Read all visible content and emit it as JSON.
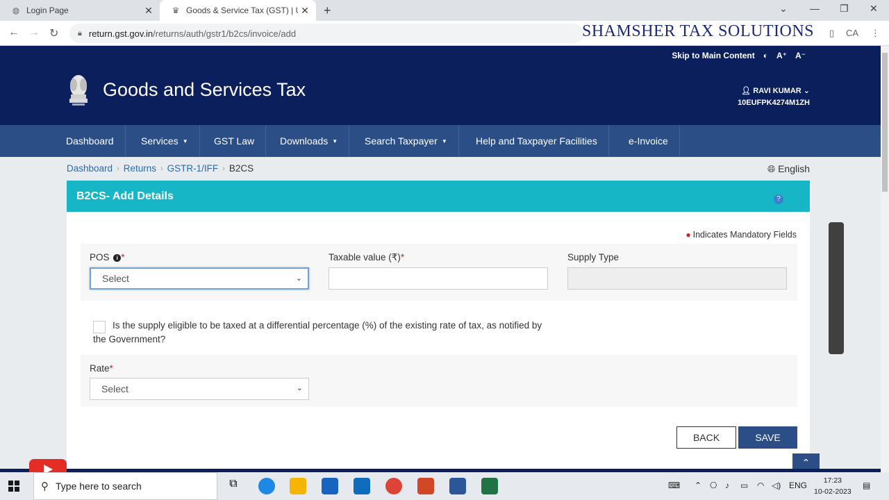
{
  "browser": {
    "tabs": [
      {
        "label": "Login Page",
        "active": false
      },
      {
        "label": "Goods & Service Tax (GST) | User",
        "active": true
      }
    ],
    "url_host": "return.gst.gov.in",
    "url_path": "/returns/auth/gstr1/b2cs/invoice/add",
    "watermark": "SHAMSHER TAX SOLUTIONS"
  },
  "header": {
    "skip_link": "Skip to Main Content",
    "font_increase": "A⁺",
    "font_decrease": "A⁻",
    "site_title": "Goods and Services Tax",
    "user_name": "RAVI KUMAR",
    "user_id": "10EUFPK4274M1ZH"
  },
  "nav": {
    "items": [
      {
        "label": "Dashboard"
      },
      {
        "label": "Services"
      },
      {
        "label": "GST Law"
      },
      {
        "label": "Downloads"
      },
      {
        "label": "Search Taxpayer"
      },
      {
        "label": "Help and Taxpayer Facilities"
      },
      {
        "label": "e-Invoice"
      }
    ]
  },
  "breadcrumb": {
    "items": [
      "Dashboard",
      "Returns",
      "GSTR-1/IFF",
      "B2CS"
    ],
    "language": "English"
  },
  "form": {
    "title": "B2CS- Add Details",
    "mandatory_note": "Indicates Mandatory Fields",
    "pos_label": "POS",
    "pos_value": "Select",
    "taxable_label": "Taxable value (₹)",
    "taxable_value": "",
    "supply_type_label": "Supply Type",
    "supply_type_value": "",
    "differential_text": "Is the supply eligible to be taxed at a differential percentage (%) of the existing rate of tax, as notified by the Government?",
    "rate_label": "Rate",
    "rate_value": "Select",
    "back_label": "BACK",
    "save_label": "SAVE"
  },
  "taskbar": {
    "search_placeholder": "Type here to search",
    "language": "ENG",
    "time": "17:23",
    "date": "10-02-2023"
  },
  "colors": {
    "header_bg": "#0b1f5c",
    "nav_bg": "#2c4e86",
    "panel_head": "#17b6c7",
    "required": "#d61c1c"
  }
}
